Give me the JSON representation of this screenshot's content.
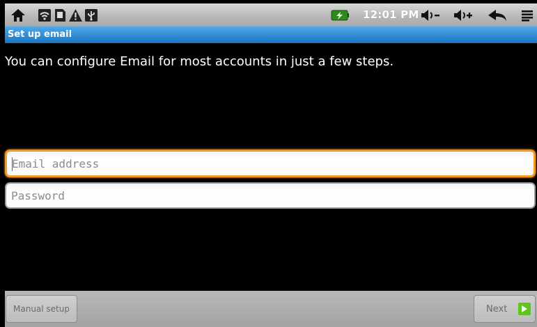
{
  "status_bar": {
    "time": "12:01 PM",
    "icons": [
      "home-icon",
      "wifi-icon",
      "sd-card-icon",
      "warning-icon",
      "usb-icon",
      "battery-icon",
      "volume-down-icon",
      "volume-up-icon",
      "back-icon",
      "menu-icon"
    ]
  },
  "title_bar": {
    "title": "Set up email"
  },
  "content": {
    "intro": "You can configure Email for most accounts in just a few steps.",
    "email": {
      "placeholder": "Email address",
      "value": ""
    },
    "password": {
      "placeholder": "Password",
      "value": ""
    }
  },
  "bottom_bar": {
    "manual_setup_label": "Manual setup",
    "next_label": "Next"
  },
  "colors": {
    "title_bar": "#1b76c4",
    "focus": "#f59a1b",
    "next_icon": "#5fc41f"
  }
}
